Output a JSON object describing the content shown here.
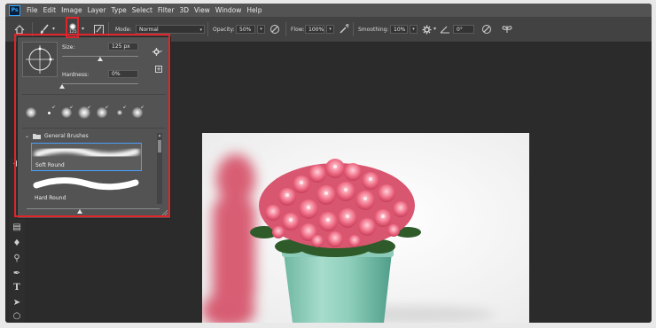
{
  "app": {
    "logo_text": "Ps"
  },
  "menu": [
    "File",
    "Edit",
    "Image",
    "Layer",
    "Type",
    "Select",
    "Filter",
    "3D",
    "View",
    "Window",
    "Help"
  ],
  "options_bar": {
    "home_icon": "home-icon",
    "brush_tool_icon": "brush-icon",
    "brush_preset_size": "125",
    "mode_label": "Mode:",
    "mode_value": "Normal",
    "opacity_label": "Opacity:",
    "opacity_value": "50%",
    "flow_label": "Flow:",
    "flow_value": "100%",
    "smoothing_label": "Smoothing:",
    "smoothing_value": "10%",
    "angle_value": "0°"
  },
  "brush_panel": {
    "size_label": "Size:",
    "size_value": "125 px",
    "hardness_label": "Hardness:",
    "hardness_value": "0%",
    "size_slider_fraction": 0.5,
    "hardness_slider_fraction": 0.0,
    "group_name": "General Brushes",
    "brushes": [
      "Soft Round",
      "Hard Round"
    ],
    "preview_slider_fraction": 0.4
  },
  "colors": {
    "highlight": "#e0242a",
    "panel_bg": "#535353",
    "workspace_bg": "#2b2b2b",
    "selected_brush_border": "#4a9eff"
  }
}
